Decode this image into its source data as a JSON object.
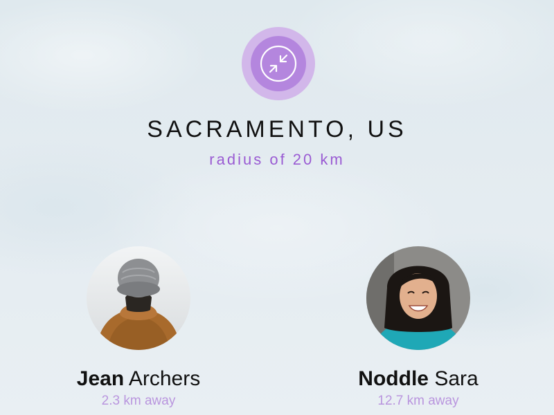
{
  "location": {
    "city": "SACRAMENTO, US",
    "radius_text": "radius of 20 km",
    "button_icon": "collapse-arrows-icon"
  },
  "people": [
    {
      "first_name": "Jean",
      "last_name": "Archers",
      "distance": "2.3 km away",
      "avatar": "person-with-beanie-avatar"
    },
    {
      "first_name": "Noddle",
      "last_name": "Sara",
      "distance": "12.7 km away",
      "avatar": "smiling-woman-avatar"
    }
  ],
  "colors": {
    "accent": "#9a5bd3",
    "button_outer": "#d2b7ea",
    "button_inner": "#b486de",
    "distance_text": "#b995de"
  }
}
